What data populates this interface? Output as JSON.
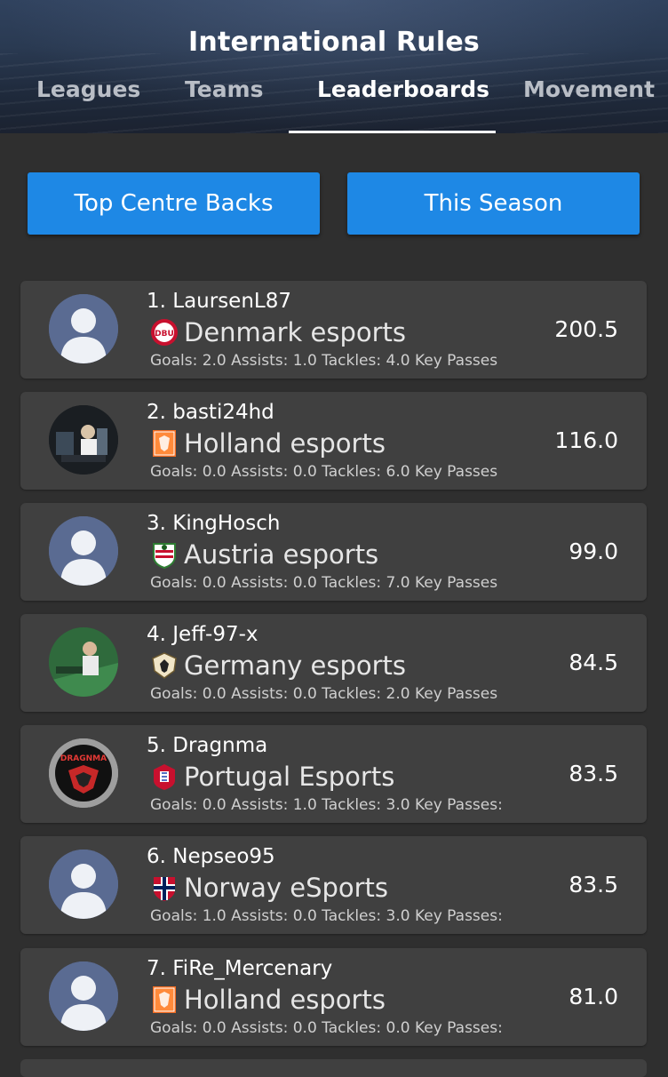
{
  "header": {
    "title": "International Rules",
    "tabs": [
      "Leagues",
      "Teams",
      "Leaderboards",
      "Movement"
    ],
    "active_tab": "Leaderboards"
  },
  "filters": {
    "category": "Top Centre Backs",
    "period": "This Season"
  },
  "leaderboard": [
    {
      "rank_name": "1. LaursenL87",
      "team": "Denmark esports",
      "score": "200.5",
      "stats": "Goals: 2.0  Assists: 1.0  Tackles: 4.0  Key Passes",
      "crest": "denmark-crest-icon",
      "avatar": "default-avatar"
    },
    {
      "rank_name": "2. basti24hd",
      "team": "Holland esports",
      "score": "116.0",
      "stats": "Goals: 0.0  Assists: 0.0  Tackles: 6.0  Key Passes",
      "crest": "holland-crest-icon",
      "avatar": "photo-avatar"
    },
    {
      "rank_name": "3. KingHosch",
      "team": "Austria esports",
      "score": "99.0",
      "stats": "Goals: 0.0  Assists: 0.0  Tackles: 7.0  Key Passes",
      "crest": "austria-crest-icon",
      "avatar": "default-avatar"
    },
    {
      "rank_name": "4. Jeff-97-x",
      "team": "Germany esports",
      "score": "84.5",
      "stats": "Goals: 0.0  Assists: 0.0  Tackles: 2.0  Key Passes",
      "crest": "germany-crest-icon",
      "avatar": "photo-avatar"
    },
    {
      "rank_name": "5. Dragnma",
      "team": "Portugal Esports",
      "score": "83.5",
      "stats": "Goals: 0.0  Assists: 1.0  Tackles: 3.0  Key Passes:",
      "crest": "portugal-crest-icon",
      "avatar": "dragnma-logo-avatar"
    },
    {
      "rank_name": "6. Nepseo95",
      "team": "Norway eSports",
      "score": "83.5",
      "stats": "Goals: 1.0  Assists: 0.0  Tackles: 3.0  Key Passes:",
      "crest": "norway-crest-icon",
      "avatar": "default-avatar"
    },
    {
      "rank_name": "7. FiRe_Mercenary",
      "team": "Holland esports",
      "score": "81.0",
      "stats": "Goals: 0.0  Assists: 0.0  Tackles: 0.0  Key Passes:",
      "crest": "holland-crest-icon",
      "avatar": "default-avatar"
    }
  ],
  "avatar_logo_text": "DRAGNMA",
  "crest_text": {
    "denmark": "DBU"
  },
  "colors": {
    "accent_button": "#1e88e5",
    "row_bg": "#404040",
    "page_bg": "#2f2f2f",
    "default_avatar_bg": "#5a6b92"
  }
}
